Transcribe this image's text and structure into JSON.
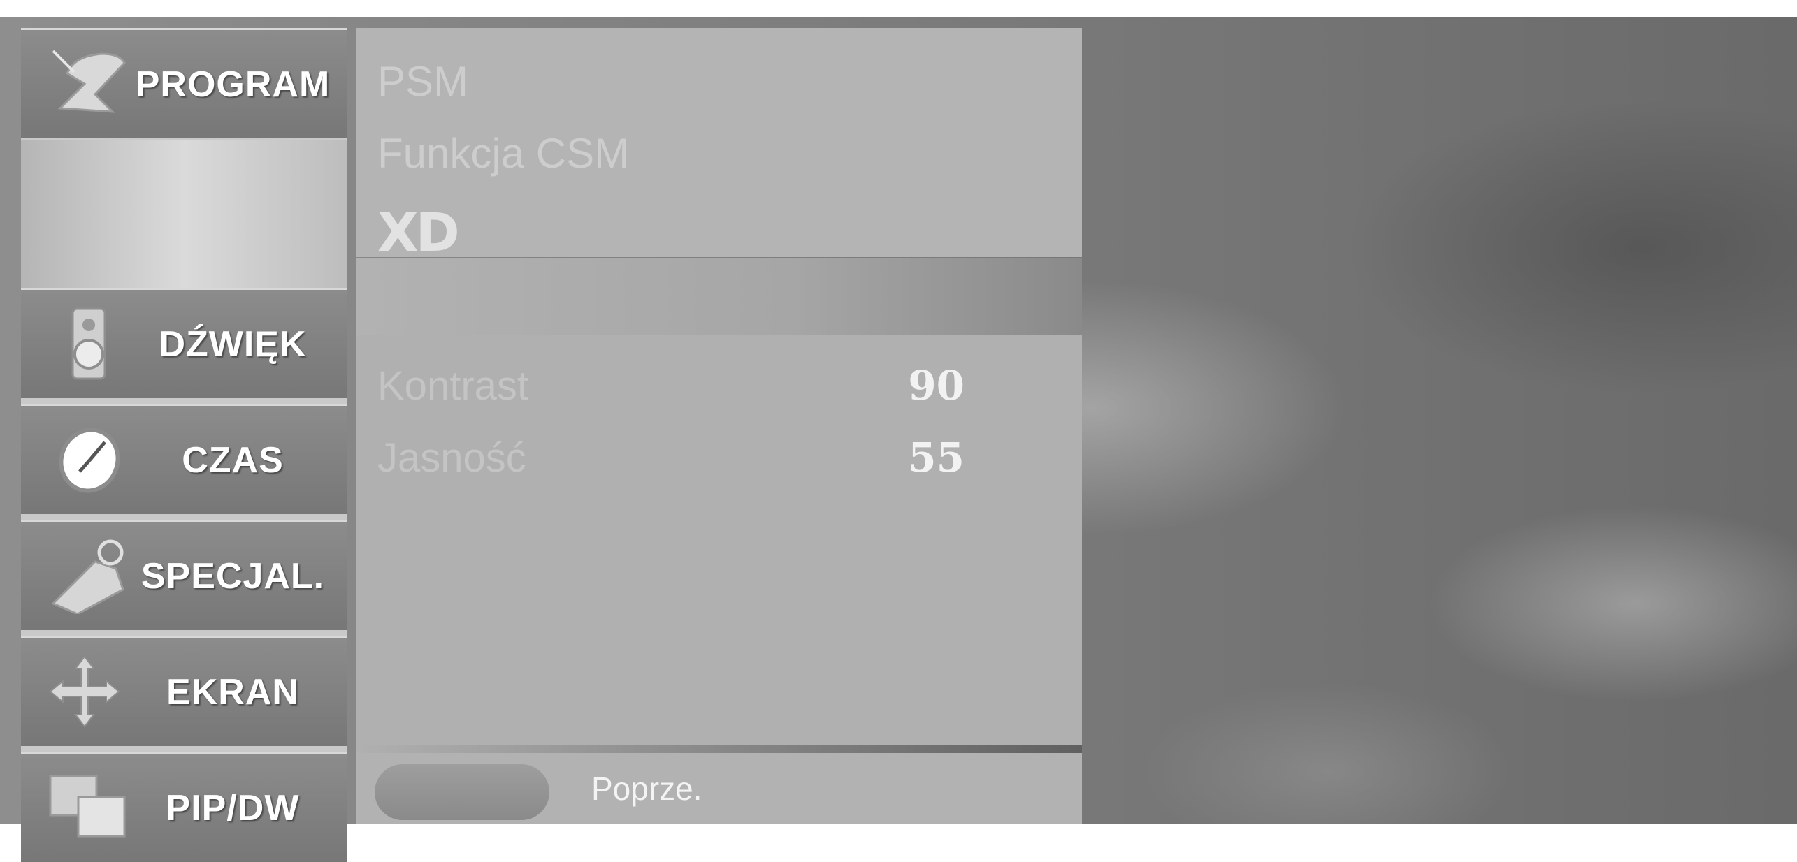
{
  "sidebar": {
    "tabs": [
      {
        "label": "PROGRAM",
        "icon": "satellite-dish-icon"
      },
      {
        "label": "DŹWIĘK",
        "icon": "speaker-icon"
      },
      {
        "label": "CZAS",
        "icon": "clock-icon"
      },
      {
        "label": "SPECJAL.",
        "icon": "tag-icon"
      },
      {
        "label": "EKRAN",
        "icon": "move-arrows-icon"
      },
      {
        "label": "PIP/DW",
        "icon": "pip-windows-icon"
      }
    ]
  },
  "picture_menu": {
    "items": [
      "PSM",
      "Funkcja CSM"
    ],
    "logo_text": "XD"
  },
  "settings": [
    {
      "label": "Kontrast",
      "value": "90"
    },
    {
      "label": "Jasność",
      "value": "55"
    }
  ],
  "footer": {
    "hint": "Poprze."
  },
  "colors": {
    "panel": "#b4b4b4",
    "tab": "#808080",
    "text_light": "#ffffff"
  }
}
